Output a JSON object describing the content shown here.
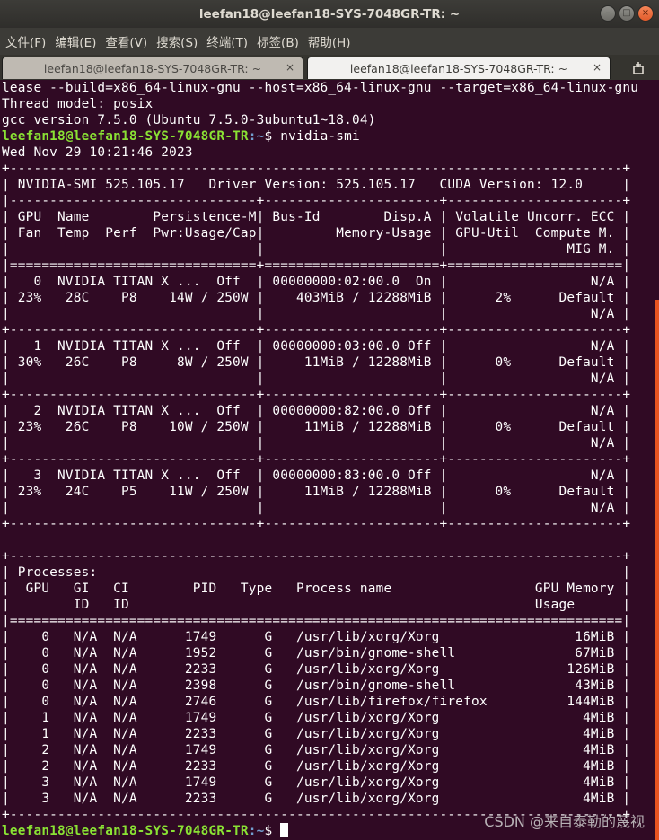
{
  "window": {
    "title": "leefan18@leefan18-SYS-7048GR-TR: ~",
    "minimize_glyph": "–",
    "maximize_glyph": "□",
    "close_glyph": "×"
  },
  "menu": [
    "文件(F)",
    "编辑(E)",
    "查看(V)",
    "搜索(S)",
    "终端(T)",
    "标签(B)",
    "帮助(H)"
  ],
  "tabs": [
    {
      "label": "leefan18@leefan18-SYS-7048GR-TR: ~",
      "close": "×"
    },
    {
      "label": "leefan18@leefan18-SYS-7048GR-TR: ~",
      "close": "×"
    }
  ],
  "prompt": {
    "user": "leefan18@leefan18-SYS-7048GR-TR",
    "path": ":~",
    "symbol": "$ "
  },
  "terminal": {
    "lines": [
      {
        "t": "lease --build=x86_64-linux-gnu --host=x86_64-linux-gnu --target=x86_64-linux-gnu"
      },
      {
        "t": "Thread model: posix"
      },
      {
        "t": "gcc version 7.5.0 (Ubuntu 7.5.0-3ubuntu1~18.04)"
      },
      {
        "p": true,
        "t": "nvidia-smi"
      },
      {
        "t": "Wed Nov 29 10:21:46 2023"
      },
      {
        "t": "+-----------------------------------------------------------------------------+"
      },
      {
        "t": "| NVIDIA-SMI 525.105.17   Driver Version: 525.105.17   CUDA Version: 12.0     |"
      },
      {
        "t": "|-------------------------------+----------------------+----------------------+"
      },
      {
        "t": "| GPU  Name        Persistence-M| Bus-Id        Disp.A | Volatile Uncorr. ECC |"
      },
      {
        "t": "| Fan  Temp  Perf  Pwr:Usage/Cap|         Memory-Usage | GPU-Util  Compute M. |"
      },
      {
        "t": "|                               |                      |               MIG M. |"
      },
      {
        "t": "|===============================+======================+======================|"
      },
      {
        "t": "|   0  NVIDIA TITAN X ...  Off  | 00000000:02:00.0  On |                  N/A |"
      },
      {
        "t": "| 23%   28C    P8    14W / 250W |    403MiB / 12288MiB |      2%      Default |"
      },
      {
        "t": "|                               |                      |                  N/A |"
      },
      {
        "t": "+-------------------------------+----------------------+----------------------+"
      },
      {
        "t": "|   1  NVIDIA TITAN X ...  Off  | 00000000:03:00.0 Off |                  N/A |"
      },
      {
        "t": "| 30%   26C    P8     8W / 250W |     11MiB / 12288MiB |      0%      Default |"
      },
      {
        "t": "|                               |                      |                  N/A |"
      },
      {
        "t": "+-------------------------------+----------------------+----------------------+"
      },
      {
        "t": "|   2  NVIDIA TITAN X ...  Off  | 00000000:82:00.0 Off |                  N/A |"
      },
      {
        "t": "| 23%   26C    P8    10W / 250W |     11MiB / 12288MiB |      0%      Default |"
      },
      {
        "t": "|                               |                      |                  N/A |"
      },
      {
        "t": "+-------------------------------+----------------------+----------------------+"
      },
      {
        "t": "|   3  NVIDIA TITAN X ...  Off  | 00000000:83:00.0 Off |                  N/A |"
      },
      {
        "t": "| 23%   24C    P5    11W / 250W |     11MiB / 12288MiB |      0%      Default |"
      },
      {
        "t": "|                               |                      |                  N/A |"
      },
      {
        "t": "+-------------------------------+----------------------+----------------------+"
      },
      {
        "t": ""
      },
      {
        "t": "+-----------------------------------------------------------------------------+"
      },
      {
        "t": "| Processes:                                                                  |"
      },
      {
        "t": "|  GPU   GI   CI        PID   Type   Process name                  GPU Memory |"
      },
      {
        "t": "|        ID   ID                                                   Usage      |"
      },
      {
        "t": "|=============================================================================|"
      },
      {
        "t": "|    0   N/A  N/A      1749      G   /usr/lib/xorg/Xorg                 16MiB |"
      },
      {
        "t": "|    0   N/A  N/A      1952      G   /usr/bin/gnome-shell               67MiB |"
      },
      {
        "t": "|    0   N/A  N/A      2233      G   /usr/lib/xorg/Xorg                126MiB |"
      },
      {
        "t": "|    0   N/A  N/A      2398      G   /usr/bin/gnome-shell               43MiB |"
      },
      {
        "t": "|    0   N/A  N/A      2746      G   /usr/lib/firefox/firefox          144MiB |"
      },
      {
        "t": "|    1   N/A  N/A      1749      G   /usr/lib/xorg/Xorg                  4MiB |"
      },
      {
        "t": "|    1   N/A  N/A      2233      G   /usr/lib/xorg/Xorg                  4MiB |"
      },
      {
        "t": "|    2   N/A  N/A      1749      G   /usr/lib/xorg/Xorg                  4MiB |"
      },
      {
        "t": "|    2   N/A  N/A      2233      G   /usr/lib/xorg/Xorg                  4MiB |"
      },
      {
        "t": "|    3   N/A  N/A      1749      G   /usr/lib/xorg/Xorg                  4MiB |"
      },
      {
        "t": "|    3   N/A  N/A      2233      G   /usr/lib/xorg/Xorg                  4MiB |"
      },
      {
        "t": "+-----------------------------------------------------------------------------+"
      },
      {
        "p": true,
        "t": "",
        "cursor": true
      }
    ]
  },
  "watermark": "CSDN @来自泰勒的蔑视",
  "icons": {
    "new_tab": "new-tab-icon"
  },
  "colors": {
    "terminal_bg": "#300a24",
    "prompt_user": "#8ae234",
    "prompt_path": "#729fcf",
    "scroll_thumb": "#e95420"
  }
}
